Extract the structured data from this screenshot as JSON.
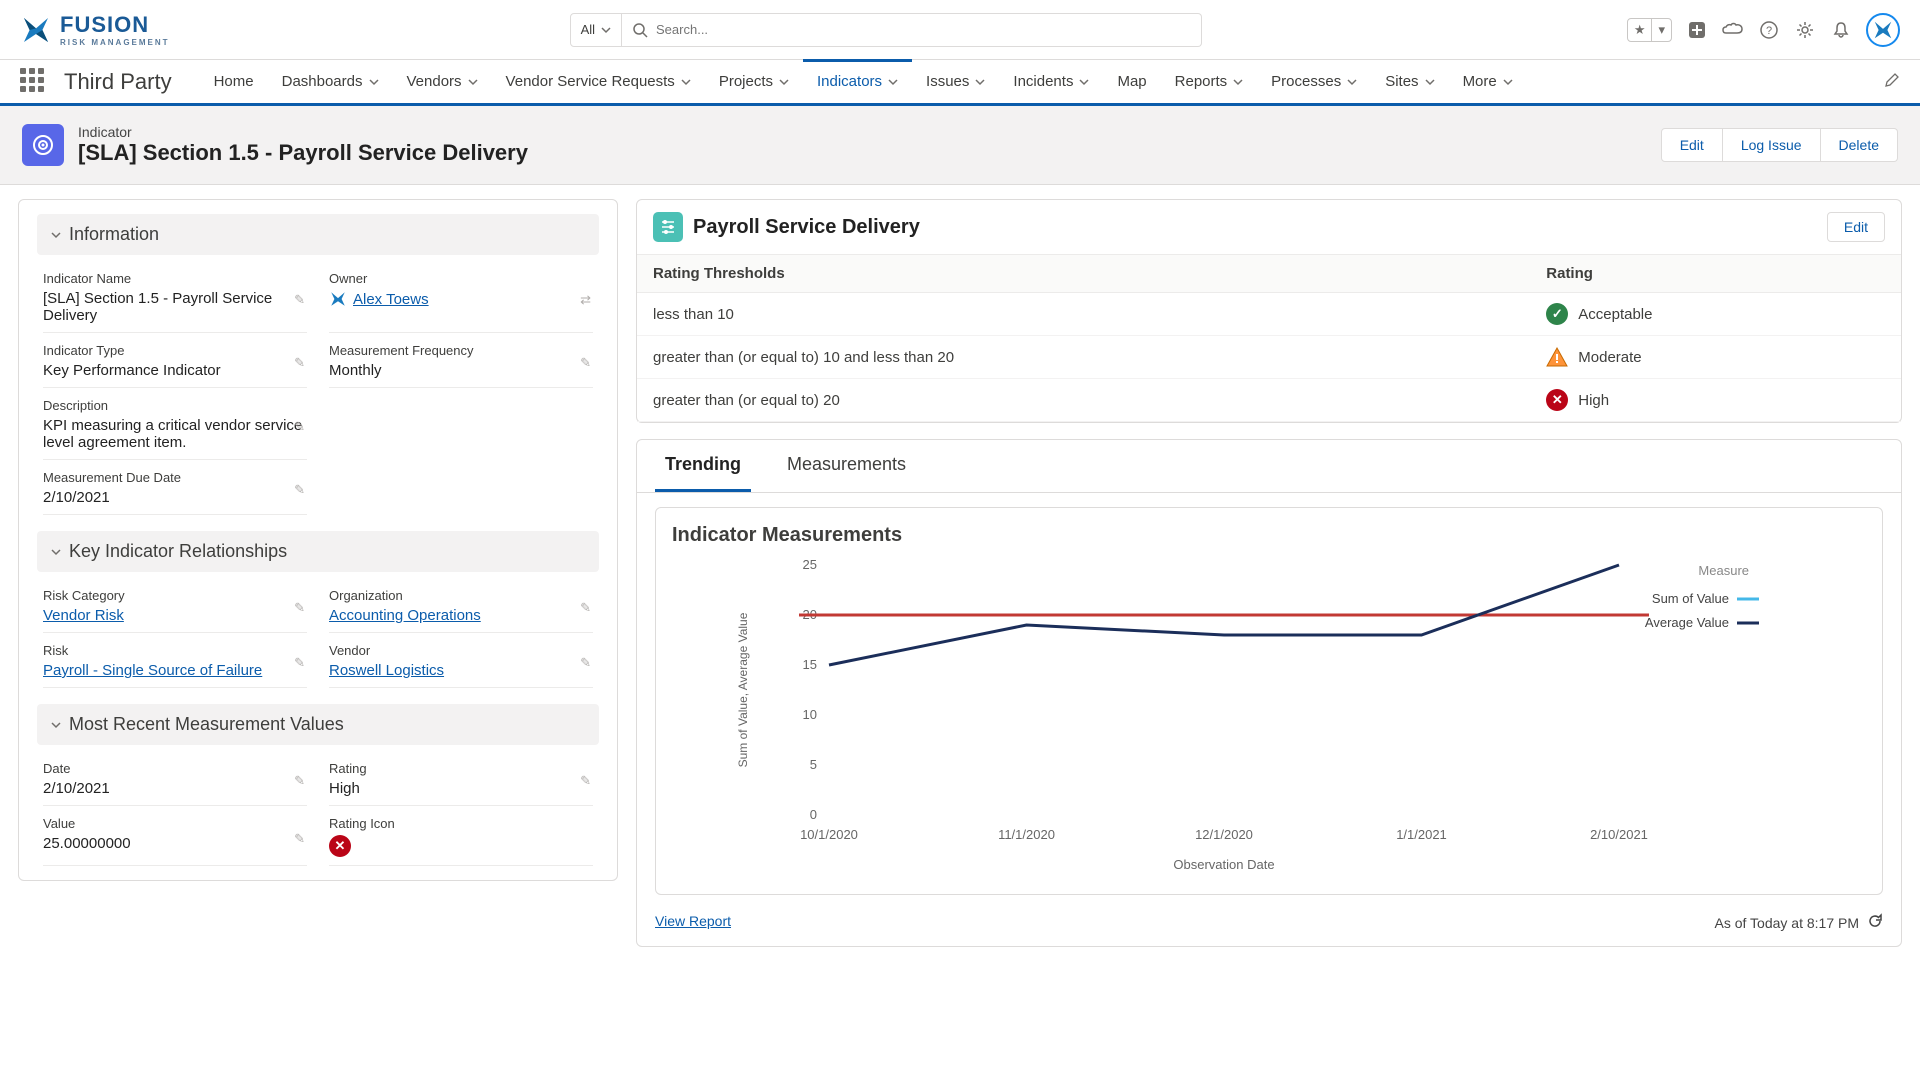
{
  "brand": {
    "name": "FUSION",
    "sub": "RISK MANAGEMENT"
  },
  "search": {
    "scope": "All",
    "placeholder": "Search..."
  },
  "appName": "Third Party",
  "nav": [
    {
      "label": "Home",
      "dd": false
    },
    {
      "label": "Dashboards",
      "dd": true
    },
    {
      "label": "Vendors",
      "dd": true
    },
    {
      "label": "Vendor Service Requests",
      "dd": true
    },
    {
      "label": "Projects",
      "dd": true
    },
    {
      "label": "Indicators",
      "dd": true,
      "active": true
    },
    {
      "label": "Issues",
      "dd": true
    },
    {
      "label": "Incidents",
      "dd": true
    },
    {
      "label": "Map",
      "dd": false
    },
    {
      "label": "Reports",
      "dd": true
    },
    {
      "label": "Processes",
      "dd": true
    },
    {
      "label": "Sites",
      "dd": true
    },
    {
      "label": "More",
      "dd": true
    }
  ],
  "pageHeader": {
    "object": "Indicator",
    "title": "[SLA] Section 1.5 - Payroll Service Delivery",
    "actions": [
      "Edit",
      "Log Issue",
      "Delete"
    ]
  },
  "sections": {
    "information": {
      "title": "Information",
      "indicator_name_label": "Indicator Name",
      "indicator_name": "[SLA] Section 1.5 - Payroll Service Delivery",
      "owner_label": "Owner",
      "owner": "Alex Toews",
      "indicator_type_label": "Indicator Type",
      "indicator_type": "Key Performance Indicator",
      "measurement_freq_label": "Measurement Frequency",
      "measurement_freq": "Monthly",
      "description_label": "Description",
      "description": "KPI measuring a critical vendor service level agreement item.",
      "due_date_label": "Measurement Due Date",
      "due_date": "2/10/2021"
    },
    "relationships": {
      "title": "Key Indicator Relationships",
      "risk_cat_label": "Risk Category",
      "risk_cat": "Vendor Risk",
      "org_label": "Organization",
      "org": "Accounting Operations",
      "risk_label": "Risk",
      "risk": "Payroll - Single Source of Failure",
      "vendor_label": "Vendor",
      "vendor": "Roswell Logistics"
    },
    "recent": {
      "title": "Most Recent Measurement Values",
      "date_label": "Date",
      "date": "2/10/2021",
      "rating_label": "Rating",
      "rating": "High",
      "value_label": "Value",
      "value": "25.00000000",
      "rating_icon_label": "Rating Icon"
    }
  },
  "payrollCard": {
    "title": "Payroll Service Delivery",
    "editLabel": "Edit",
    "col_threshold": "Rating Thresholds",
    "col_rating": "Rating",
    "rows": [
      {
        "threshold": "less than 10",
        "rating": "Acceptable",
        "kind": "ok"
      },
      {
        "threshold": "greater than (or equal to) 10 and less than 20",
        "rating": "Moderate",
        "kind": "warn"
      },
      {
        "threshold": "greater than (or equal to) 20",
        "rating": "High",
        "kind": "high"
      }
    ]
  },
  "trendCard": {
    "tabs": [
      "Trending",
      "Measurements"
    ],
    "chartTitle": "Indicator Measurements",
    "viewReport": "View Report",
    "asOf": "As of Today at 8:17 PM",
    "legend": {
      "title": "Measure",
      "sum": "Sum of Value",
      "avg": "Average Value"
    },
    "yAxisLabel": "Sum of Value, Average Value",
    "xAxisLabel": "Observation Date"
  },
  "chart_data": {
    "type": "line",
    "categories": [
      "10/1/2020",
      "11/1/2020",
      "12/1/2020",
      "1/1/2021",
      "2/10/2021"
    ],
    "series": [
      {
        "name": "Sum of Value",
        "values": [
          15,
          19,
          18,
          18,
          25
        ],
        "color": "#44b8e8"
      },
      {
        "name": "Average Value",
        "values": [
          20,
          20,
          20,
          20,
          20
        ],
        "color": "#c23934"
      }
    ],
    "ylim": [
      0,
      25
    ],
    "xlabel": "Observation Date",
    "ylabel": "Sum of Value, Average Value",
    "title": "Indicator Measurements"
  }
}
